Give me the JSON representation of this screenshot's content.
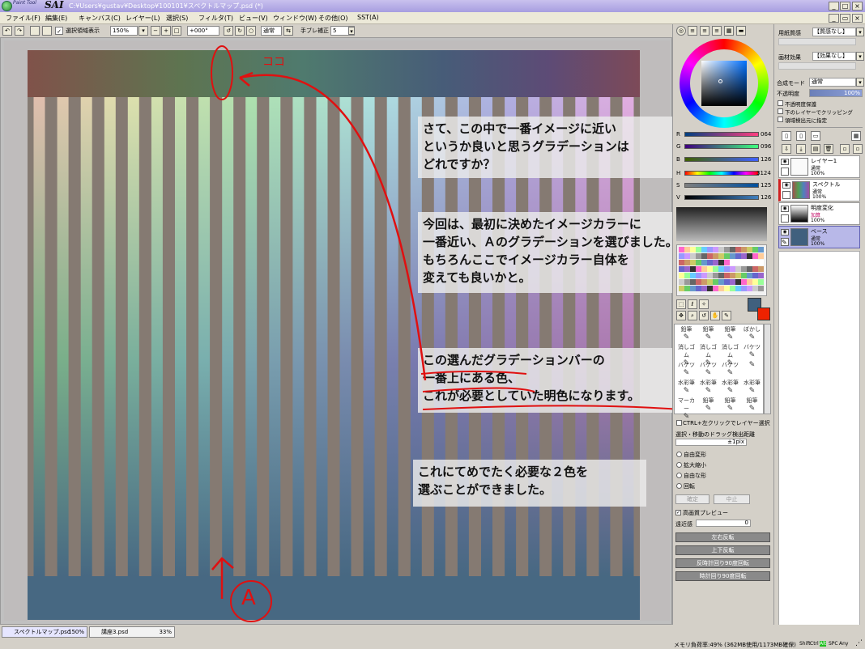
{
  "window": {
    "brand_small": "Paint Tool",
    "brand_big": "SAI",
    "path": "C:¥Users¥gustav¥Desktop¥100101¥スペクトルマップ.psd (*)"
  },
  "menu": [
    "ファイル(F)",
    "編集(E)",
    "キャンバス(C)",
    "レイヤー(L)",
    "選択(S)",
    "フィルタ(T)",
    "ビュー(V)",
    "ウィンドウ(W)",
    "その他(O)",
    "SST(A)"
  ],
  "toolbar": {
    "show_selection": "選択領域表示",
    "zoom": "150%",
    "rotation": "+000°",
    "blend": "通常",
    "stabilizer_label": "手ブレ補正",
    "stabilizer_value": "5"
  },
  "notes": {
    "n1": "さて、この中で一番イメージに近い\nというか良いと思うグラデーションは\nどれですか？",
    "n2": "今回は、最初に決めたイメージカラーに\n一番近い、Ａのグラデーションを選びました。\nもちろんここでイメージカラー自体を\n変えても良いかと。",
    "n3": "この選んだグラデーションバーの\n一番上にある色、\nこれが必要としていた明色になります。",
    "n4": "これにてめでたく必要な２色を\n選ぶことができました。"
  },
  "annotations": {
    "koko": "ココ",
    "a_mark": "A"
  },
  "color": {
    "r_label": "R",
    "r": "064",
    "g_label": "G",
    "g": "096",
    "b_label": "B",
    "b": "126",
    "h_label": "H",
    "h": "3124",
    "s_label": "S",
    "s": "125",
    "v_label": "V",
    "v": "126",
    "current": "#40607e",
    "secondary": "#ee2200"
  },
  "brushes": [
    "鉛筆",
    "鉛筆",
    "鉛筆",
    "ぼかし",
    "消しゴム",
    "消しゴム",
    "消しゴム",
    "バケツ",
    "バケツ",
    "バケツ",
    "バケツ",
    "",
    "水彩筆",
    "水彩筆",
    "水彩筆",
    "水彩筆",
    "マーカー",
    "鉛筆",
    "鉛筆",
    "鉛筆"
  ],
  "tool_options": {
    "ctrl_click": "CTRL+左クリックでレイヤー選択",
    "drag_threshold": "選択・移動のドラッグ検出距離",
    "threshold_value": "±1pix",
    "transform_options": [
      "自由変形",
      "拡大縮小",
      "自由な形",
      "回転"
    ],
    "ok": "確定",
    "cancel": "中止",
    "hq_preview": "高画質プレビュー",
    "perspective": "遠近感",
    "perspective_value": "0",
    "actions": [
      "左右反転",
      "上下反転",
      "反時計回り90度回転",
      "時計回り90度回転"
    ]
  },
  "layer_panel": {
    "texture_label": "用紙質感",
    "texture_value": "【質感なし】",
    "effect_label": "画材効果",
    "effect_value": "【効果なし】",
    "blend_label": "合成モード",
    "blend_value": "通常",
    "opacity_label": "不透明度",
    "opacity_value": "100%",
    "checks": [
      "不透明度保護",
      "下のレイヤーでクリッピング",
      "領域検出元に指定"
    ],
    "layers": [
      {
        "name": "レイヤー1",
        "mode": "通常",
        "opacity": "100%"
      },
      {
        "name": "スペクトル",
        "mode": "通常",
        "opacity": "100%"
      },
      {
        "name": "明度変化",
        "mode": "加算",
        "opacity": "100%"
      },
      {
        "name": "ベース",
        "mode": "通常",
        "opacity": "100%"
      }
    ]
  },
  "status": {
    "tabs": [
      {
        "name": "スペクトルマップ.psd",
        "zoom": "150%"
      },
      {
        "name": "講座3.psd",
        "zoom": "33%"
      }
    ],
    "memory": "メモリ負荷率:49% (362MB使用/1173MB確保)",
    "keys": [
      "Shift",
      "Ctrl",
      "Alt",
      "SPC",
      "Any"
    ]
  }
}
